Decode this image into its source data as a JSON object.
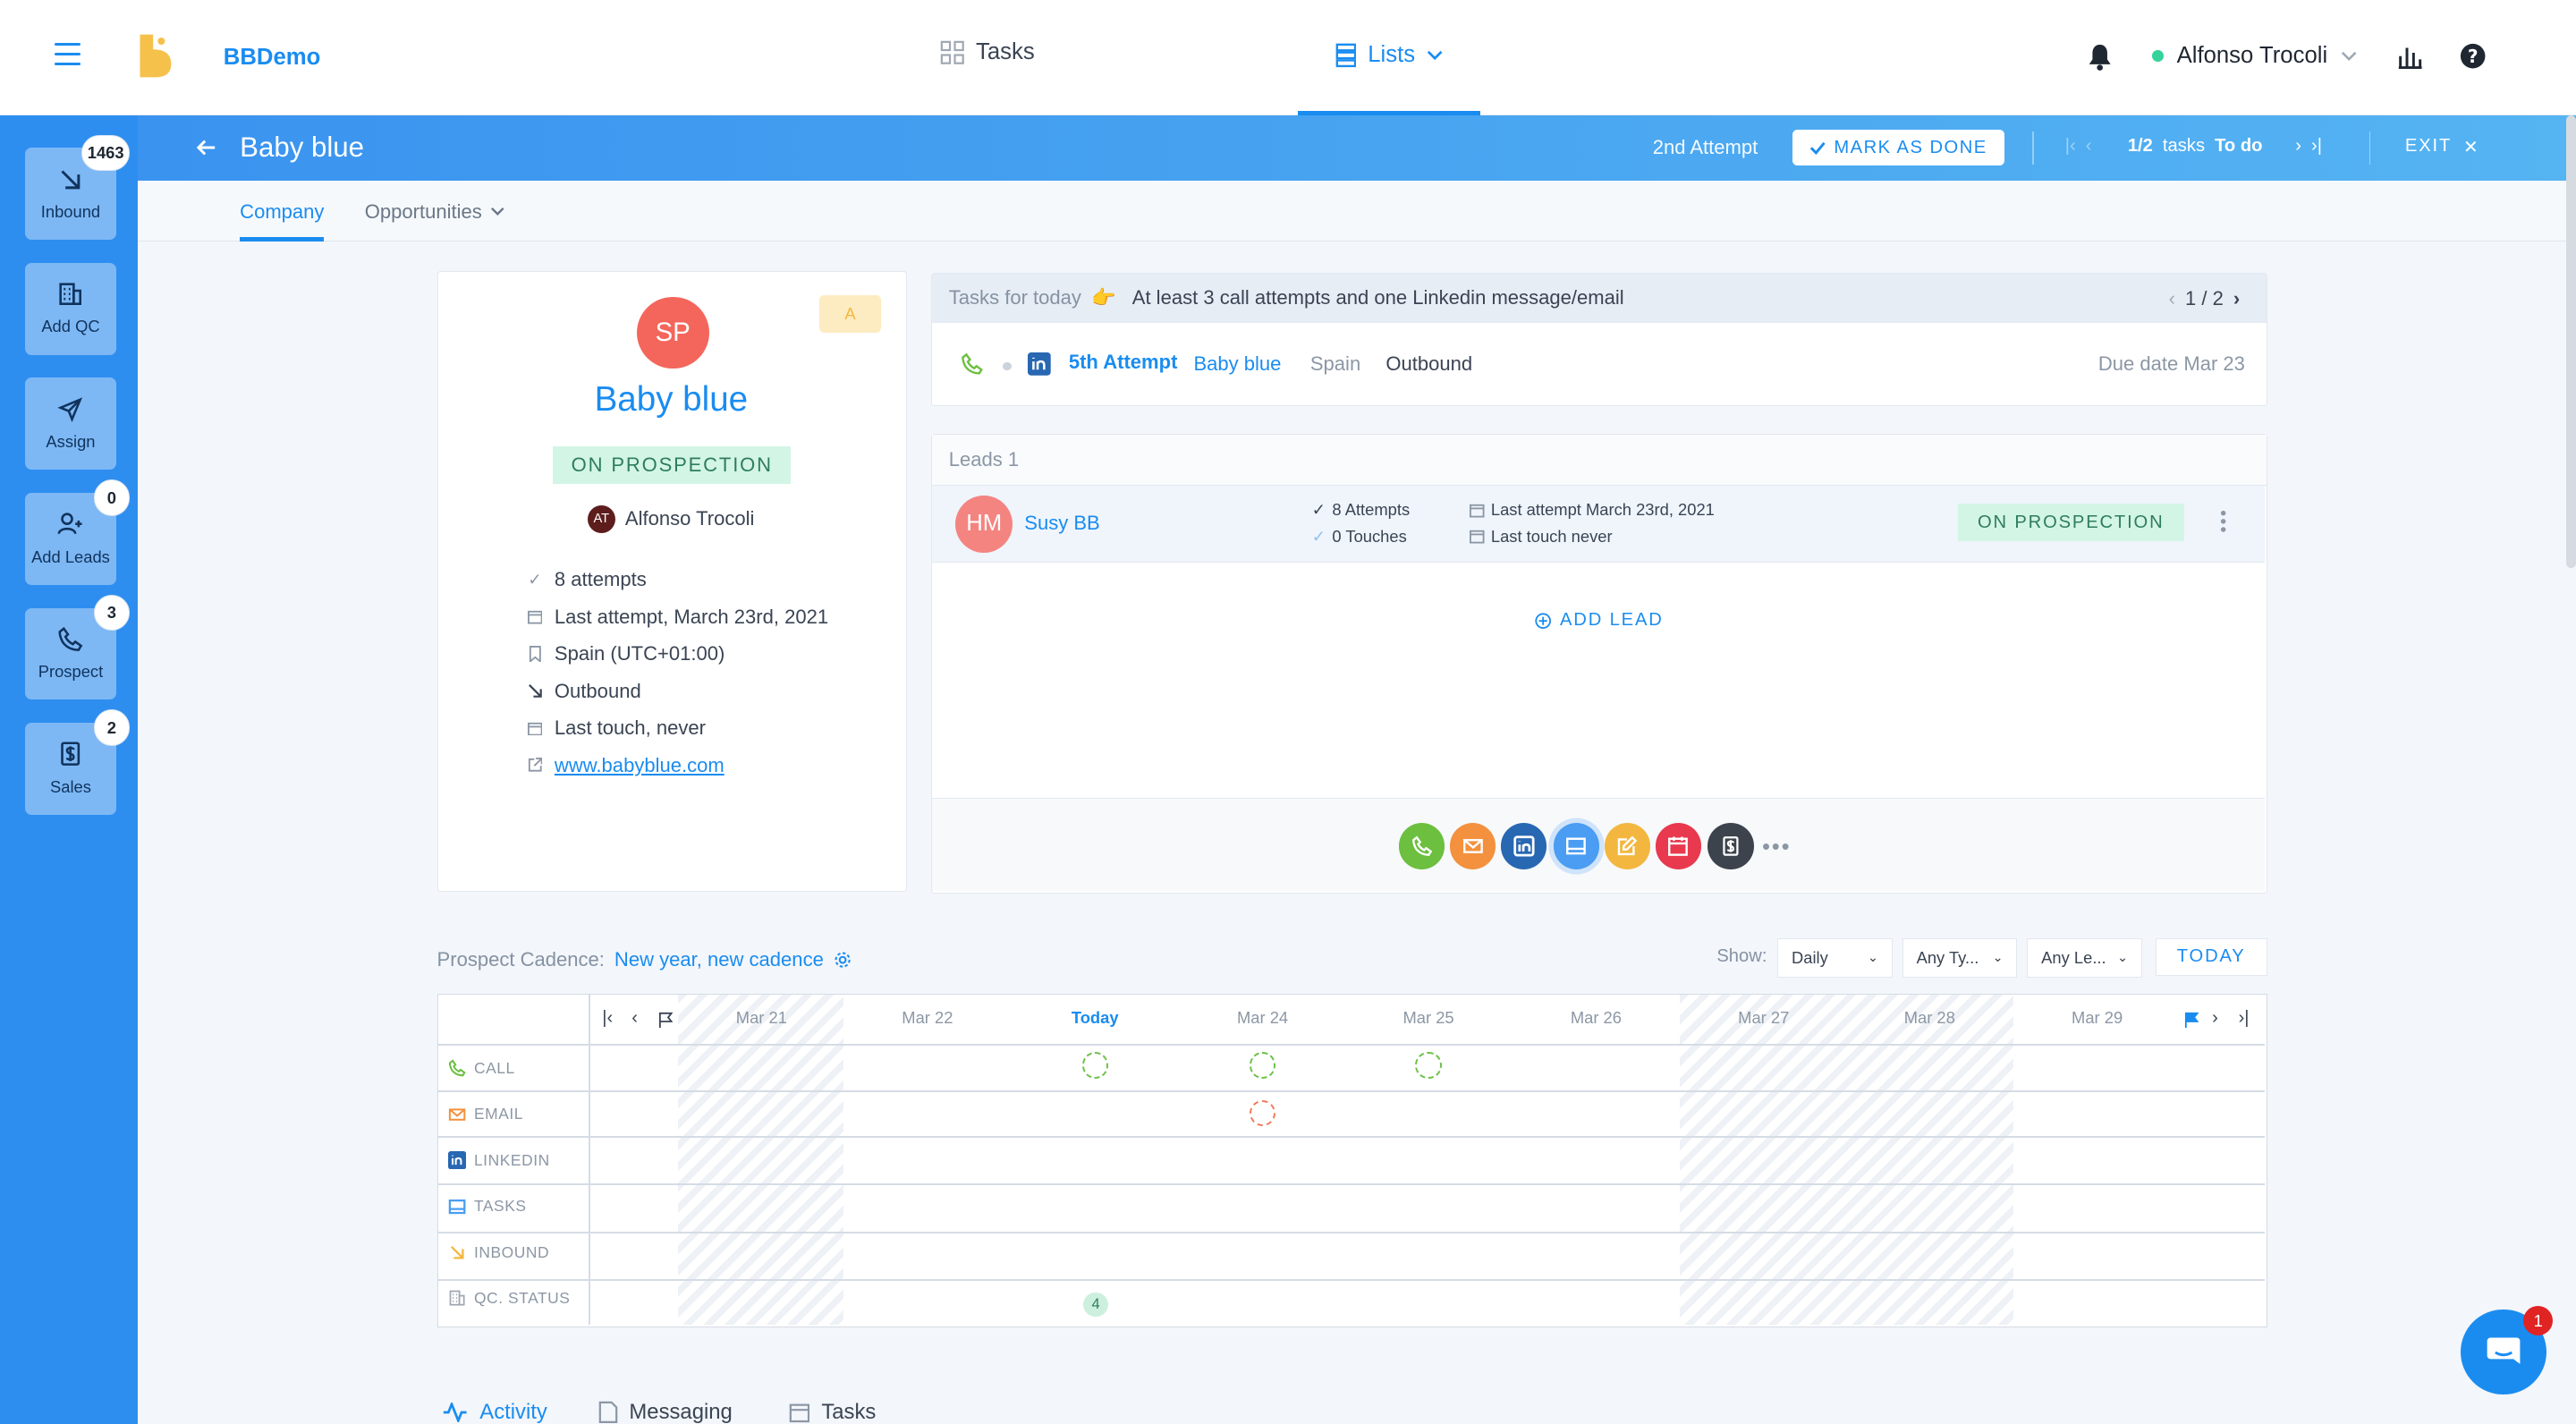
{
  "topbar": {
    "brand": "BBDemo",
    "nav_tasks": "Tasks",
    "nav_lists": "Lists",
    "user_name": "Alfonso Trocoli"
  },
  "sidebar": {
    "items": [
      {
        "label": "Inbound",
        "badge": "1463",
        "icon": "arrow-down-right-icon"
      },
      {
        "label": "Add QC",
        "badge": "",
        "icon": "building-icon"
      },
      {
        "label": "Assign",
        "badge": "",
        "icon": "send-icon"
      },
      {
        "label": "Add Leads",
        "badge": "0",
        "icon": "user-plus-icon"
      },
      {
        "label": "Prospect",
        "badge": "3",
        "icon": "phone-icon"
      },
      {
        "label": "Sales",
        "badge": "2",
        "icon": "dollar-icon"
      }
    ]
  },
  "header": {
    "title": "Baby blue",
    "attempt": "2nd Attempt",
    "mark_done": "MARK AS DONE",
    "pager_count": "1/2",
    "pager_word": "tasks",
    "pager_status": "To do",
    "exit": "EXIT"
  },
  "subtabs": {
    "company": "Company",
    "opportunities": "Opportunities"
  },
  "company": {
    "initials": "SP",
    "grade": "A",
    "name": "Baby blue",
    "status": "ON PROSPECTION",
    "owner_initials": "AT",
    "owner": "Alfonso Trocoli",
    "facts": [
      {
        "icon": "check-icon",
        "text": "8 attempts"
      },
      {
        "icon": "calendar-icon",
        "text": "Last attempt, March 23rd, 2021"
      },
      {
        "icon": "bookmark-icon",
        "text": "Spain (UTC+01:00)"
      },
      {
        "icon": "arrow-down-right-icon",
        "text": "Outbound"
      },
      {
        "icon": "calendar-icon",
        "text": "Last touch, never"
      }
    ],
    "website": "www.babyblue.com"
  },
  "tasks_today": {
    "label": "Tasks for today",
    "emoji": "👉",
    "description": "At least 3 call attempts and one Linkedin message/email",
    "pager": "1 / 2",
    "task": {
      "attempt": "5th Attempt",
      "company": "Baby blue",
      "country": "Spain",
      "direction": "Outbound",
      "due": "Due date Mar 23"
    }
  },
  "leads": {
    "header": "Leads 1",
    "lead": {
      "initials": "HM",
      "name": "Susy BB",
      "attempts": "8 Attempts",
      "touches": "0 Touches",
      "last_attempt": "Last attempt March 23rd, 2021",
      "last_touch": "Last touch never",
      "status": "ON PROSPECTION"
    },
    "add_lead": "ADD LEAD",
    "actions": [
      {
        "icon": "phone-icon",
        "color": "#6cbf3f"
      },
      {
        "icon": "mail-icon",
        "color": "#f3913e"
      },
      {
        "icon": "linkedin-icon",
        "color": "#2867b2"
      },
      {
        "icon": "tasks-icon",
        "color": "#4a9df2"
      },
      {
        "icon": "note-icon",
        "color": "#f3b73f"
      },
      {
        "icon": "calendar-icon",
        "color": "#e8394f"
      },
      {
        "icon": "dollar-icon",
        "color": "#3d434c"
      }
    ],
    "more": "•••"
  },
  "cadence": {
    "label": "Prospect Cadence:",
    "name": "New year, new cadence",
    "show_label": "Show:",
    "filter_period": "Daily",
    "filter_type": "Any Ty...",
    "filter_lead": "Any Le...",
    "today_btn": "TODAY",
    "days": [
      "Mar 21",
      "Mar 22",
      "Today",
      "Mar 24",
      "Mar 25",
      "Mar 26",
      "Mar 27",
      "Mar 28",
      "Mar 29"
    ],
    "rows": [
      {
        "label": "CALL",
        "icon": "phone-icon",
        "color": "#6cbf3f"
      },
      {
        "label": "EMAIL",
        "icon": "mail-icon",
        "color": "#f3913e"
      },
      {
        "label": "LINKEDIN",
        "icon": "linkedin-icon",
        "color": "#2867b2"
      },
      {
        "label": "TASKS",
        "icon": "tasks-icon",
        "color": "#4a9df2"
      },
      {
        "label": "INBOUND",
        "icon": "arrow-down-right-icon",
        "color": "#f3b73f"
      },
      {
        "label": "QC. STATUS",
        "icon": "building-icon",
        "color": "#a0a8b3"
      }
    ],
    "qc_count": "4"
  },
  "bottom_tabs": [
    "Activity",
    "Messaging",
    "Tasks"
  ],
  "chat_badge": "1",
  "colors": {
    "accent": "#1a8cf0",
    "sidebar": "#2e8ef0",
    "status_green": "#d3f5e6"
  }
}
